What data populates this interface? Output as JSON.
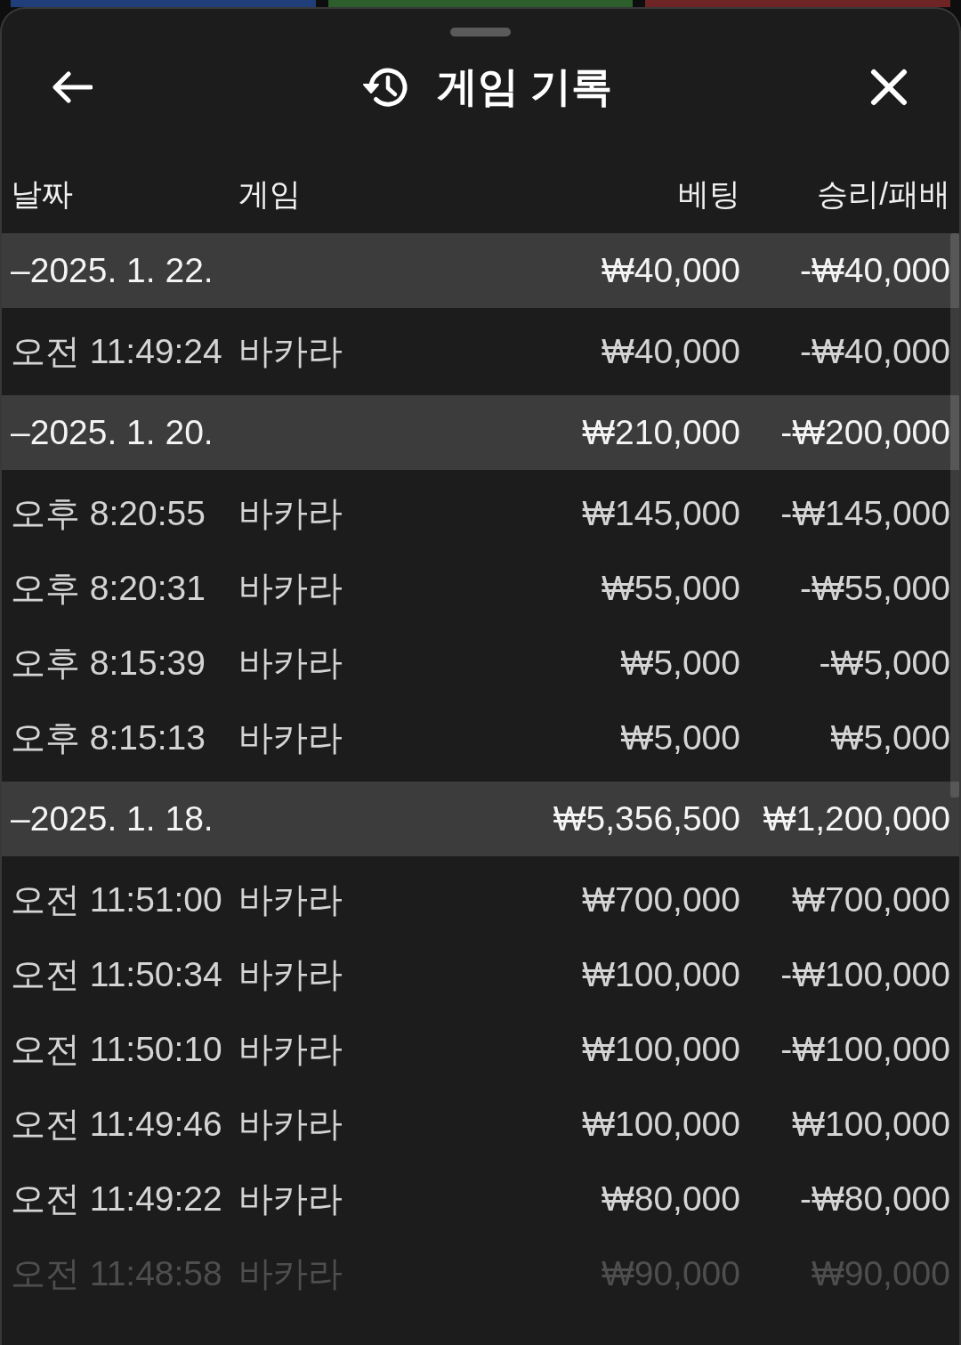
{
  "background_panels": [
    {
      "color": "#203f7a"
    },
    {
      "color": "#2d5f2d"
    },
    {
      "color": "#6e2424"
    }
  ],
  "header": {
    "title": "게임 기록"
  },
  "table": {
    "columns": [
      "날짜",
      "게임",
      "베팅",
      "승리/패배"
    ],
    "groups": [
      {
        "date": "–2025. 1. 22.",
        "bet": "₩40,000",
        "result": "-₩40,000",
        "rows": [
          {
            "time": "오전 11:49:24",
            "game": "바카라",
            "bet": "₩40,000",
            "result": "-₩40,000"
          }
        ]
      },
      {
        "date": "–2025. 1. 20.",
        "bet": "₩210,000",
        "result": "-₩200,000",
        "rows": [
          {
            "time": "오후 8:20:55",
            "game": "바카라",
            "bet": "₩145,000",
            "result": "-₩145,000"
          },
          {
            "time": "오후 8:20:31",
            "game": "바카라",
            "bet": "₩55,000",
            "result": "-₩55,000"
          },
          {
            "time": "오후 8:15:39",
            "game": "바카라",
            "bet": "₩5,000",
            "result": "-₩5,000"
          },
          {
            "time": "오후 8:15:13",
            "game": "바카라",
            "bet": "₩5,000",
            "result": "₩5,000"
          }
        ]
      },
      {
        "date": "–2025. 1. 18.",
        "bet": "₩5,356,500",
        "result": "₩1,200,000",
        "rows": [
          {
            "time": "오전 11:51:00",
            "game": "바카라",
            "bet": "₩700,000",
            "result": "₩700,000"
          },
          {
            "time": "오전 11:50:34",
            "game": "바카라",
            "bet": "₩100,000",
            "result": "-₩100,000"
          },
          {
            "time": "오전 11:50:10",
            "game": "바카라",
            "bet": "₩100,000",
            "result": "-₩100,000"
          },
          {
            "time": "오전 11:49:46",
            "game": "바카라",
            "bet": "₩100,000",
            "result": "₩100,000"
          },
          {
            "time": "오전 11:49:22",
            "game": "바카라",
            "bet": "₩80,000",
            "result": "-₩80,000"
          },
          {
            "time": "오전 11:48:58",
            "game": "바카라",
            "bet": "₩90,000",
            "result": "₩90,000"
          }
        ]
      }
    ]
  }
}
